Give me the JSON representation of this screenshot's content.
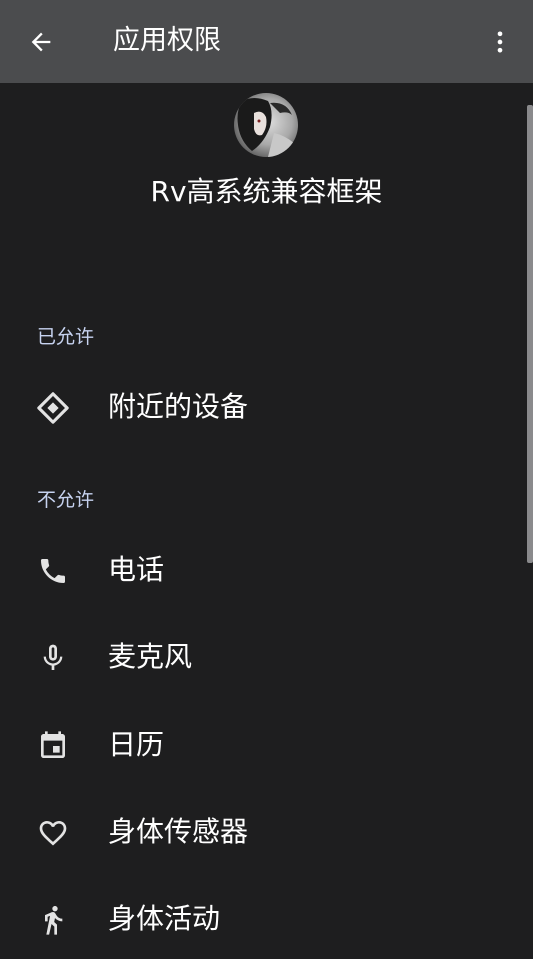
{
  "header": {
    "title": "应用权限",
    "back_icon": "arrow-back-icon",
    "more_icon": "more-vert-icon"
  },
  "app": {
    "name": "Rv高系统兼容框架",
    "avatar_icon": "app-avatar"
  },
  "sections": {
    "allowed": {
      "title": "已允许",
      "items": [
        {
          "label": "附近的设备",
          "icon": "nearby-devices-icon"
        }
      ]
    },
    "denied": {
      "title": "不允许",
      "items": [
        {
          "label": "电话",
          "icon": "phone-icon"
        },
        {
          "label": "麦克风",
          "icon": "microphone-icon"
        },
        {
          "label": "日历",
          "icon": "calendar-icon"
        },
        {
          "label": "身体传感器",
          "icon": "heart-icon"
        },
        {
          "label": "身体活动",
          "icon": "walk-icon"
        }
      ]
    }
  },
  "colors": {
    "topbar": "#4b4c4e",
    "background": "#1e1e1f",
    "section_header": "#c7d3f0",
    "icon": "#e3e3e3"
  }
}
